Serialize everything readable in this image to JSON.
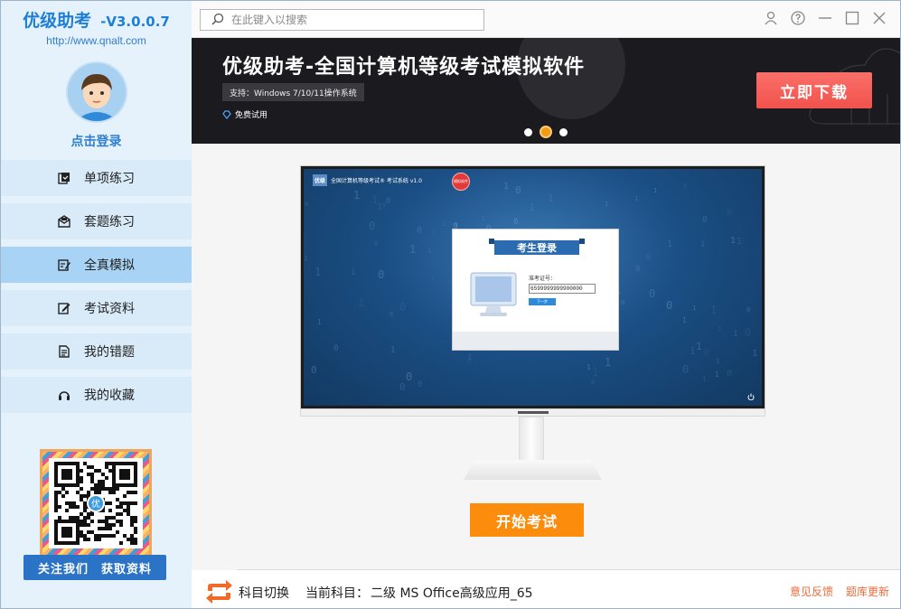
{
  "app": {
    "name": "优级助考",
    "version": "-V3.0.0.7",
    "url": "http://www.qnalt.com",
    "login_text": "点击登录"
  },
  "sidebar": {
    "items": [
      {
        "label": "单项练习",
        "icon": "single-practice-icon",
        "active": false
      },
      {
        "label": "套题练习",
        "icon": "set-practice-icon",
        "active": false
      },
      {
        "label": "全真模拟",
        "icon": "mock-exam-icon",
        "active": true
      },
      {
        "label": "考试资料",
        "icon": "materials-icon",
        "active": false
      },
      {
        "label": "我的错题",
        "icon": "wrong-questions-icon",
        "active": false
      },
      {
        "label": "我的收藏",
        "icon": "favorites-icon",
        "active": false
      }
    ],
    "qr_follow": "关注我们",
    "qr_get": "获取资料",
    "qr_center_char": "优"
  },
  "search": {
    "placeholder": "在此键入以搜索"
  },
  "banner": {
    "title": "优级助考-全国计算机等级考试模拟软件",
    "tag": "支持：Windows 7/10/11操作系统",
    "free": "免费试用",
    "cta": "立即下载",
    "slides": 3,
    "active_slide": 2
  },
  "preview": {
    "title": "全国计算机等级考试® 考试系统 v1.0",
    "title_mark": "优级",
    "badge": "模拟软件",
    "dialog_title": "考生登录",
    "id_label": "准考证号：",
    "id_value": "6599999999900000",
    "next_btn": "下一步"
  },
  "start_button": "开始考试",
  "bottom": {
    "switch_label": "科目切换",
    "current_subject_label": "当前科目：",
    "current_subject": "二级 MS Office高级应用_65",
    "feedback": "意见反馈",
    "update": "题库更新"
  },
  "colors": {
    "brand_blue": "#1e7fd6",
    "sidebar_bg": "#e6f2fb",
    "active_item": "#a8d3f4",
    "cta_red": "#f1524c",
    "start_orange": "#fb8c0c",
    "link_orange": "#ee6a3a"
  }
}
